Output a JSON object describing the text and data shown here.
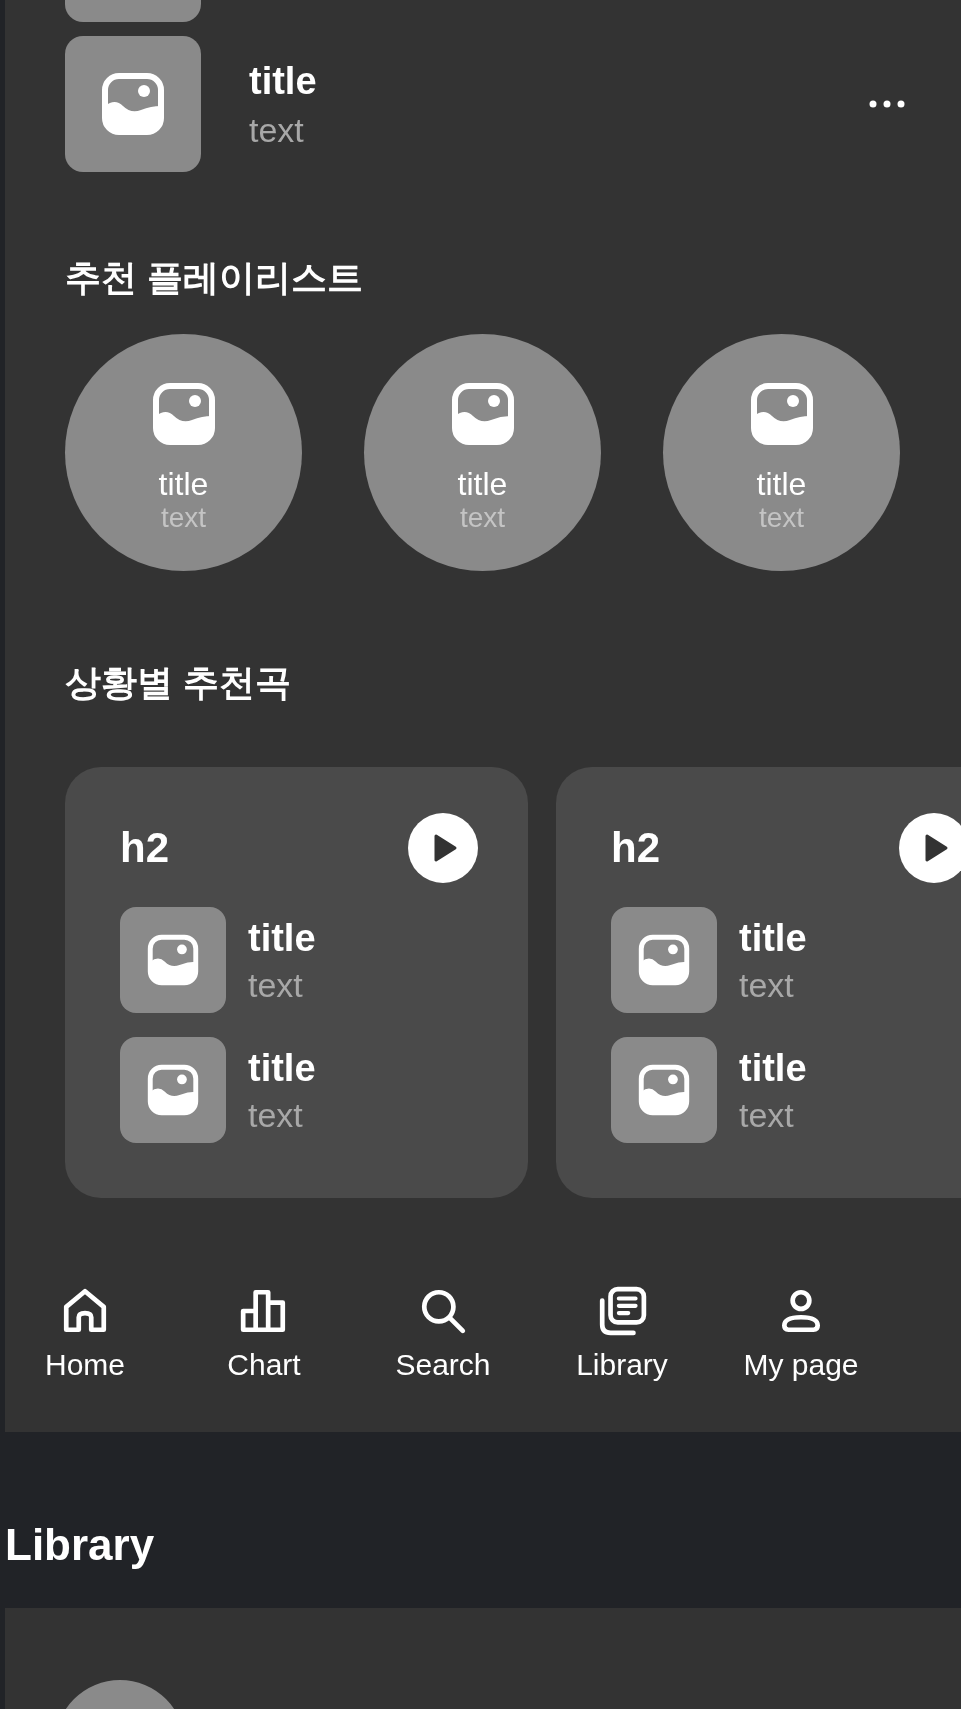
{
  "songs": [
    {
      "title": "title",
      "text": "text"
    }
  ],
  "playlist_section": {
    "heading": "추천 플레이리스트",
    "playlists": [
      {
        "title": "title",
        "text": "text"
      },
      {
        "title": "title",
        "text": "text"
      },
      {
        "title": "title",
        "text": "text"
      }
    ]
  },
  "situation_section": {
    "heading": "상황별 추천곡",
    "cards": [
      {
        "heading": "h2",
        "tracks": [
          {
            "title": "title",
            "text": "text"
          },
          {
            "title": "title",
            "text": "text"
          }
        ]
      },
      {
        "heading": "h2",
        "tracks": [
          {
            "title": "title",
            "text": "text"
          },
          {
            "title": "title",
            "text": "text"
          }
        ]
      }
    ]
  },
  "nav": [
    {
      "label": "Home",
      "kind": "home"
    },
    {
      "label": "Chart",
      "kind": "chart"
    },
    {
      "label": "Search",
      "kind": "search"
    },
    {
      "label": "Library",
      "kind": "library"
    },
    {
      "label": "My page",
      "kind": "profile"
    }
  ],
  "library": {
    "heading": "Library"
  }
}
